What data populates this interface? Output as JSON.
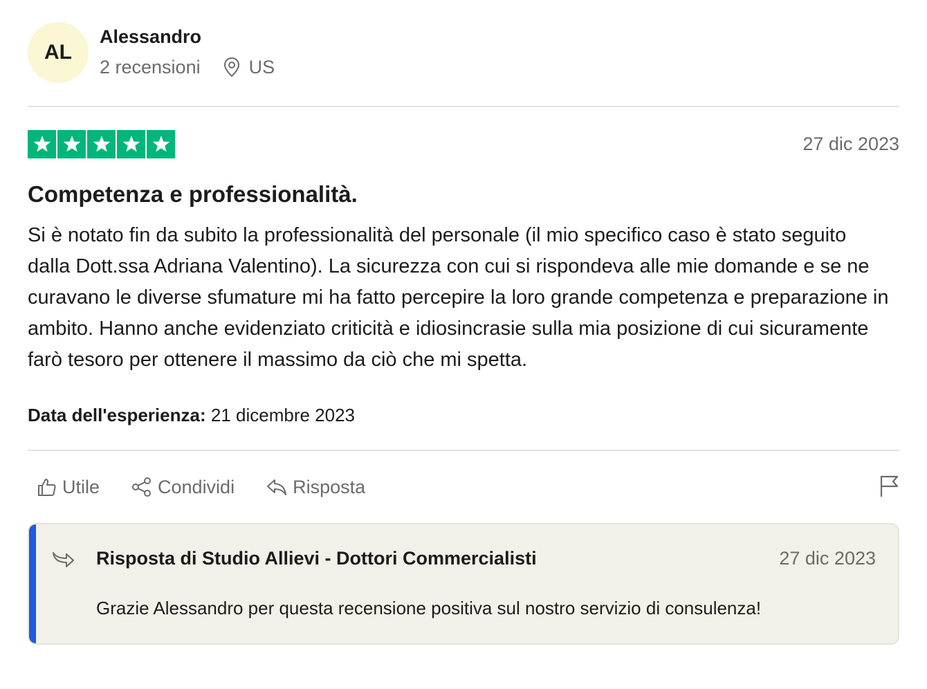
{
  "reviewer": {
    "initials": "AL",
    "name": "Alessandro",
    "review_count": "2 recensioni",
    "location": "US",
    "avatar_color": "#fbf6d3"
  },
  "review": {
    "rating": 5,
    "rating_max": 5,
    "star_color": "#00b67a",
    "date": "27 dic 2023",
    "title": "Competenza e professionalità.",
    "body": "Si è notato fin da subito la professionalità del personale (il mio specifico caso è stato seguito dalla Dott.ssa Adriana Valentino). La sicurezza con cui si rispondeva alle mie domande e se ne curavano le diverse sfumature mi ha fatto percepire la loro grande competenza e preparazione in ambito. Hanno anche evidenziato criticità e idiosincrasie sulla mia posizione di cui sicuramente farò tesoro per ottenere il massimo da ciò che mi spetta.",
    "experience_label": "Data dell'esperienza:",
    "experience_date": "21 dicembre 2023"
  },
  "actions": {
    "useful_label": "Utile",
    "useful_icon": "thumbs-up-icon",
    "share_label": "Condividi",
    "share_icon": "share-icon",
    "reply_label": "Risposta",
    "reply_icon": "reply-icon",
    "flag_icon": "flag-icon"
  },
  "reply": {
    "title": "Risposta di Studio Allievi - Dottori Commercialisti",
    "date": "27 dic 2023",
    "text": "Grazie Alessandro per questa recensione positiva sul nostro servizio di consulenza!",
    "accent_color": "#1e5ade",
    "icon": "reply-arrow-icon"
  }
}
